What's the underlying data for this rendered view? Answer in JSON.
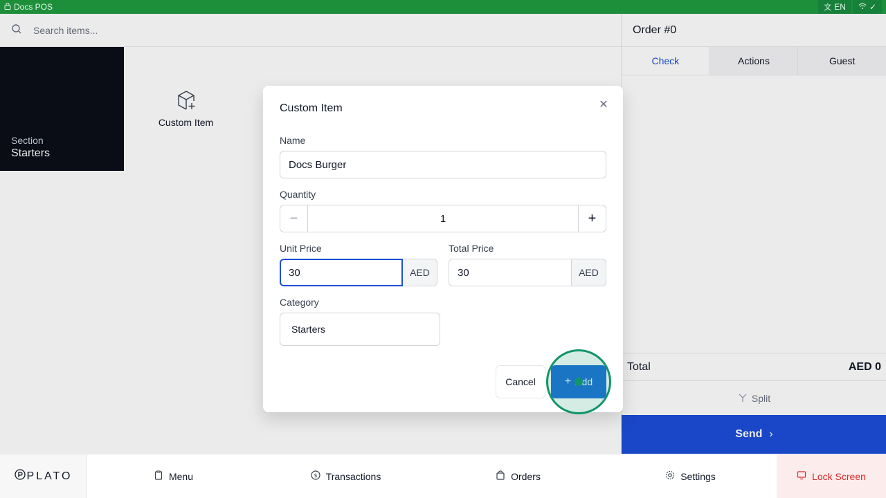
{
  "status_bar": {
    "app_name": "Docs POS",
    "language": "EN"
  },
  "search": {
    "placeholder": "Search items..."
  },
  "section_tile": {
    "label": "Section",
    "value": "Starters"
  },
  "custom_tile": {
    "label": "Custom Item"
  },
  "order": {
    "title": "Order #0",
    "tabs": [
      {
        "label": "Check"
      },
      {
        "label": "Actions"
      },
      {
        "label": "Guest"
      }
    ],
    "total_label": "Total",
    "total_value": "AED 0",
    "split_label": "Split",
    "send_label": "Send"
  },
  "bottom_nav": {
    "logo": "PLATO",
    "items": [
      {
        "label": "Menu",
        "icon": "clipboard-icon"
      },
      {
        "label": "Transactions",
        "icon": "coin-icon"
      },
      {
        "label": "Orders",
        "icon": "bag-icon"
      },
      {
        "label": "Settings",
        "icon": "gear-icon"
      }
    ],
    "lock_label": "Lock Screen"
  },
  "modal": {
    "title": "Custom Item",
    "name_label": "Name",
    "name_value": "Docs Burger",
    "quantity_label": "Quantity",
    "quantity_value": "1",
    "unit_price_label": "Unit Price",
    "unit_price_value": "30",
    "total_price_label": "Total Price",
    "total_price_value": "30",
    "currency": "AED",
    "category_label": "Category",
    "category_value": "Starters",
    "cancel_label": "Cancel",
    "add_label": "Add"
  },
  "colors": {
    "status_green": "#1d8f3a",
    "primary_blue": "#1d4ed8",
    "lock_red": "#dc2626"
  }
}
